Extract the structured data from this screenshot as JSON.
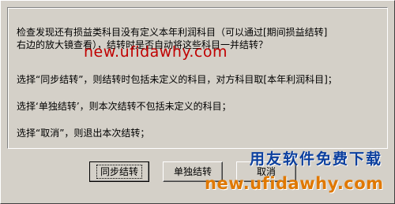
{
  "message": {
    "line1": "检查发现还有损益类科目没有定义本年利润科目（可以通过[期间损益结转]",
    "line2": "右边的放大镜查看），结转时是否自动将这些科目一并结转？",
    "line3": "选择“同步结转”，则结转时包括未定义的科目，对方科目取[本年利润科目]；",
    "line4": "选择‘单独结转’，则本次结转不包括未定义的科目；",
    "line5": "选择“取消”，则退出本次结转；"
  },
  "buttons": {
    "sync_label": "同步结转",
    "separate_label": "单独结转",
    "cancel_label": "取消"
  },
  "watermarks": {
    "top_url": "new.ufidawhy.com",
    "logo_text": "用友软件免费下载",
    "bottom_url": "new.ufidawhy.com"
  }
}
